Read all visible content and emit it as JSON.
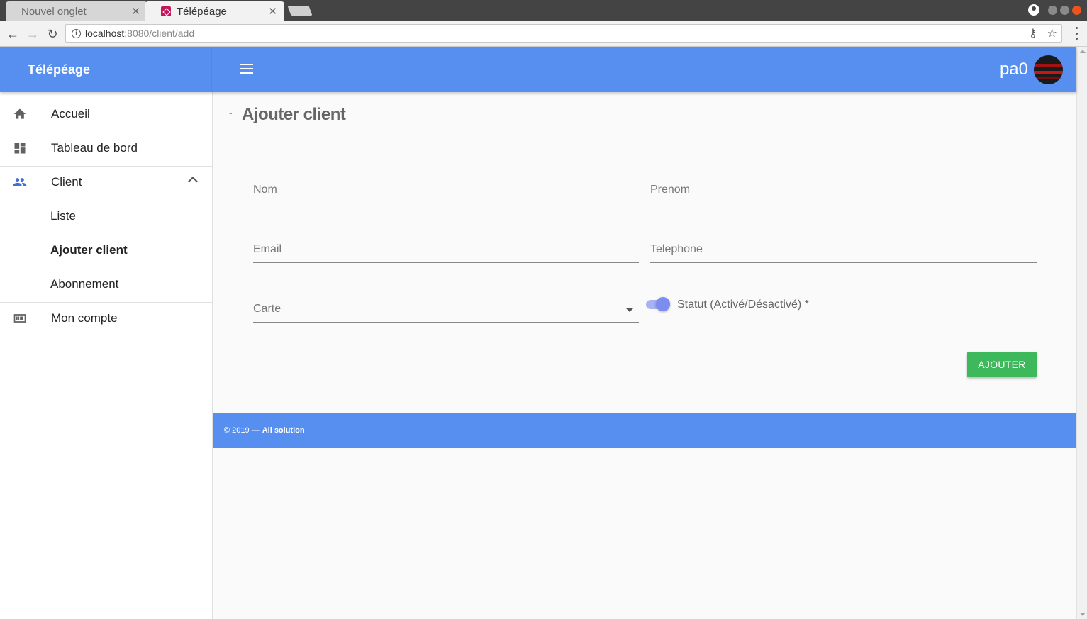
{
  "browser": {
    "tabs": [
      {
        "label": "Nouvel onglet",
        "active": false
      },
      {
        "label": "Télépéage",
        "active": true
      }
    ],
    "url_host": "localhost",
    "url_rest": ":8080/client/add"
  },
  "header": {
    "brand": "Télépéage",
    "username": "pa0"
  },
  "sidebar": {
    "items": [
      {
        "label": "Accueil",
        "icon": "home-icon"
      },
      {
        "label": "Tableau de bord",
        "icon": "dashboard-icon"
      },
      {
        "label": "Client",
        "icon": "people-icon",
        "expanded": true
      },
      {
        "label": "Liste"
      },
      {
        "label": "Ajouter client",
        "active": true
      },
      {
        "label": "Abonnement"
      },
      {
        "label": "Mon compte",
        "icon": "account-card-icon"
      }
    ]
  },
  "main": {
    "title": "Ajouter client",
    "fields": {
      "nom": {
        "placeholder": "Nom",
        "value": ""
      },
      "prenom": {
        "placeholder": "Prenom",
        "value": ""
      },
      "email": {
        "placeholder": "Email",
        "value": ""
      },
      "telephone": {
        "placeholder": "Telephone",
        "value": ""
      },
      "carte": {
        "placeholder": "Carte",
        "value": ""
      }
    },
    "statut_label": "Statut (Activé/Désactivé) *",
    "statut_on": true,
    "submit_label": "AJOUTER"
  },
  "footer": {
    "copyright": "© 2019 —",
    "company": "All solution"
  },
  "colors": {
    "primary": "#578ff0",
    "success": "#3db85a",
    "toggle": "#7c8df2"
  }
}
